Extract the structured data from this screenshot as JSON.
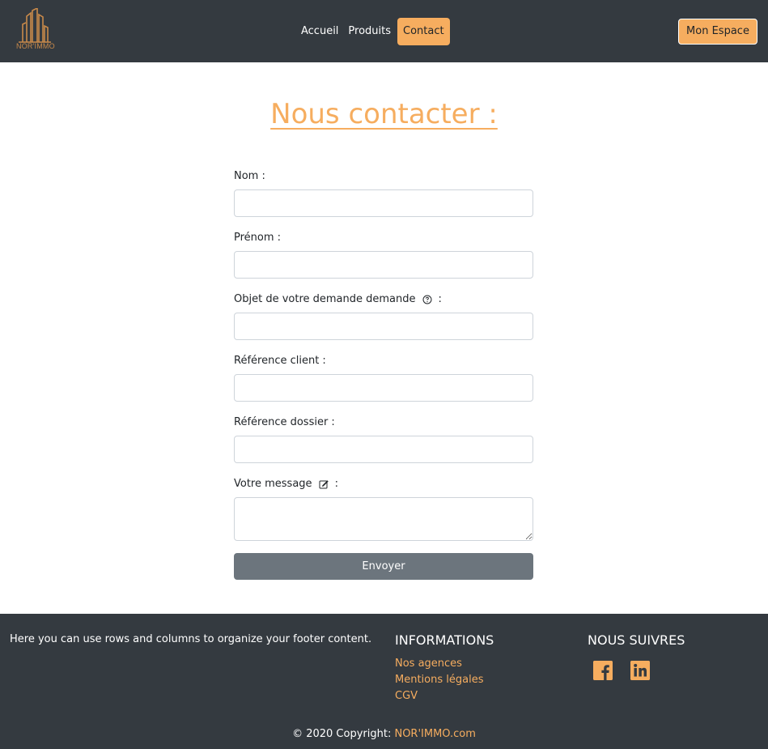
{
  "brand": {
    "name": "NOR'IMMO",
    "logo_icon": "building-logo-icon",
    "accent": "#f6ad5f",
    "dark": "#343a40"
  },
  "nav": {
    "links": [
      {
        "label": "Accueil",
        "active": false
      },
      {
        "label": "Produits",
        "active": false
      },
      {
        "label": "Contact",
        "active": true
      }
    ],
    "account_button": "Mon Espace"
  },
  "page": {
    "title": "Nous contacter :"
  },
  "form": {
    "fields": [
      {
        "label": "Nom :",
        "value": ""
      },
      {
        "label": "Prénom :",
        "value": ""
      },
      {
        "label": "Objet de votre demande demande",
        "suffix": ":",
        "icon": "question-circle-icon",
        "value": ""
      },
      {
        "label": "Référence client :",
        "value": ""
      },
      {
        "label": "Référence dossier :",
        "value": ""
      },
      {
        "label": "Votre message",
        "suffix": ":",
        "icon": "edit-icon",
        "value": ""
      }
    ],
    "submit_label": "Envoyer"
  },
  "footer": {
    "description": "Here you can use rows and columns to organize your footer content.",
    "info_title": "INFORMATIONS",
    "info_links": [
      "Nos agences",
      "Mentions légales",
      "CGV"
    ],
    "social_title": "NOUS SUIVRES",
    "socials": [
      "facebook-icon",
      "linkedin-icon"
    ],
    "copyright_text": "© 2020 Copyright:",
    "copyright_link": "NOR'IMMO.com"
  }
}
